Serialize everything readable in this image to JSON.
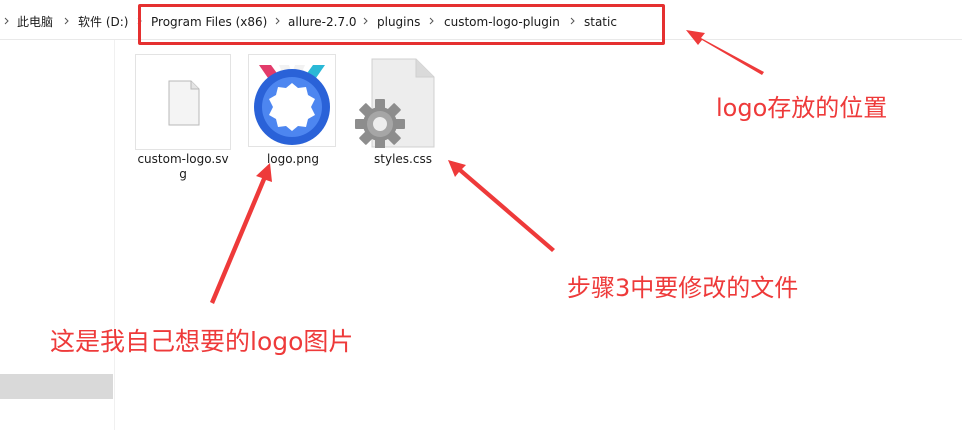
{
  "breadcrumb": {
    "items": [
      {
        "label": "此电脑"
      },
      {
        "label": "软件 (D:)"
      },
      {
        "label": "Program Files (x86)"
      },
      {
        "label": "allure-2.7.0"
      },
      {
        "label": "plugins"
      },
      {
        "label": "custom-logo-plugin"
      },
      {
        "label": "static"
      }
    ]
  },
  "files": [
    {
      "name_line1": "custom-logo.sv",
      "name_line2": "g",
      "icon": "blank-file-icon"
    },
    {
      "name": "logo.png",
      "icon": "allure-logo-image"
    },
    {
      "name": "styles.css",
      "icon": "css-settings-file-icon"
    }
  ],
  "annotations": {
    "location": "logo存放的位置",
    "file_to_edit": "步骤3中要修改的文件",
    "my_logo": "这是我自己想要的logo图片"
  },
  "colors": {
    "annotation_red": "#ee3a3a",
    "logo_blue": "#2a62d8",
    "selected_nav": "#d9d9d9"
  }
}
